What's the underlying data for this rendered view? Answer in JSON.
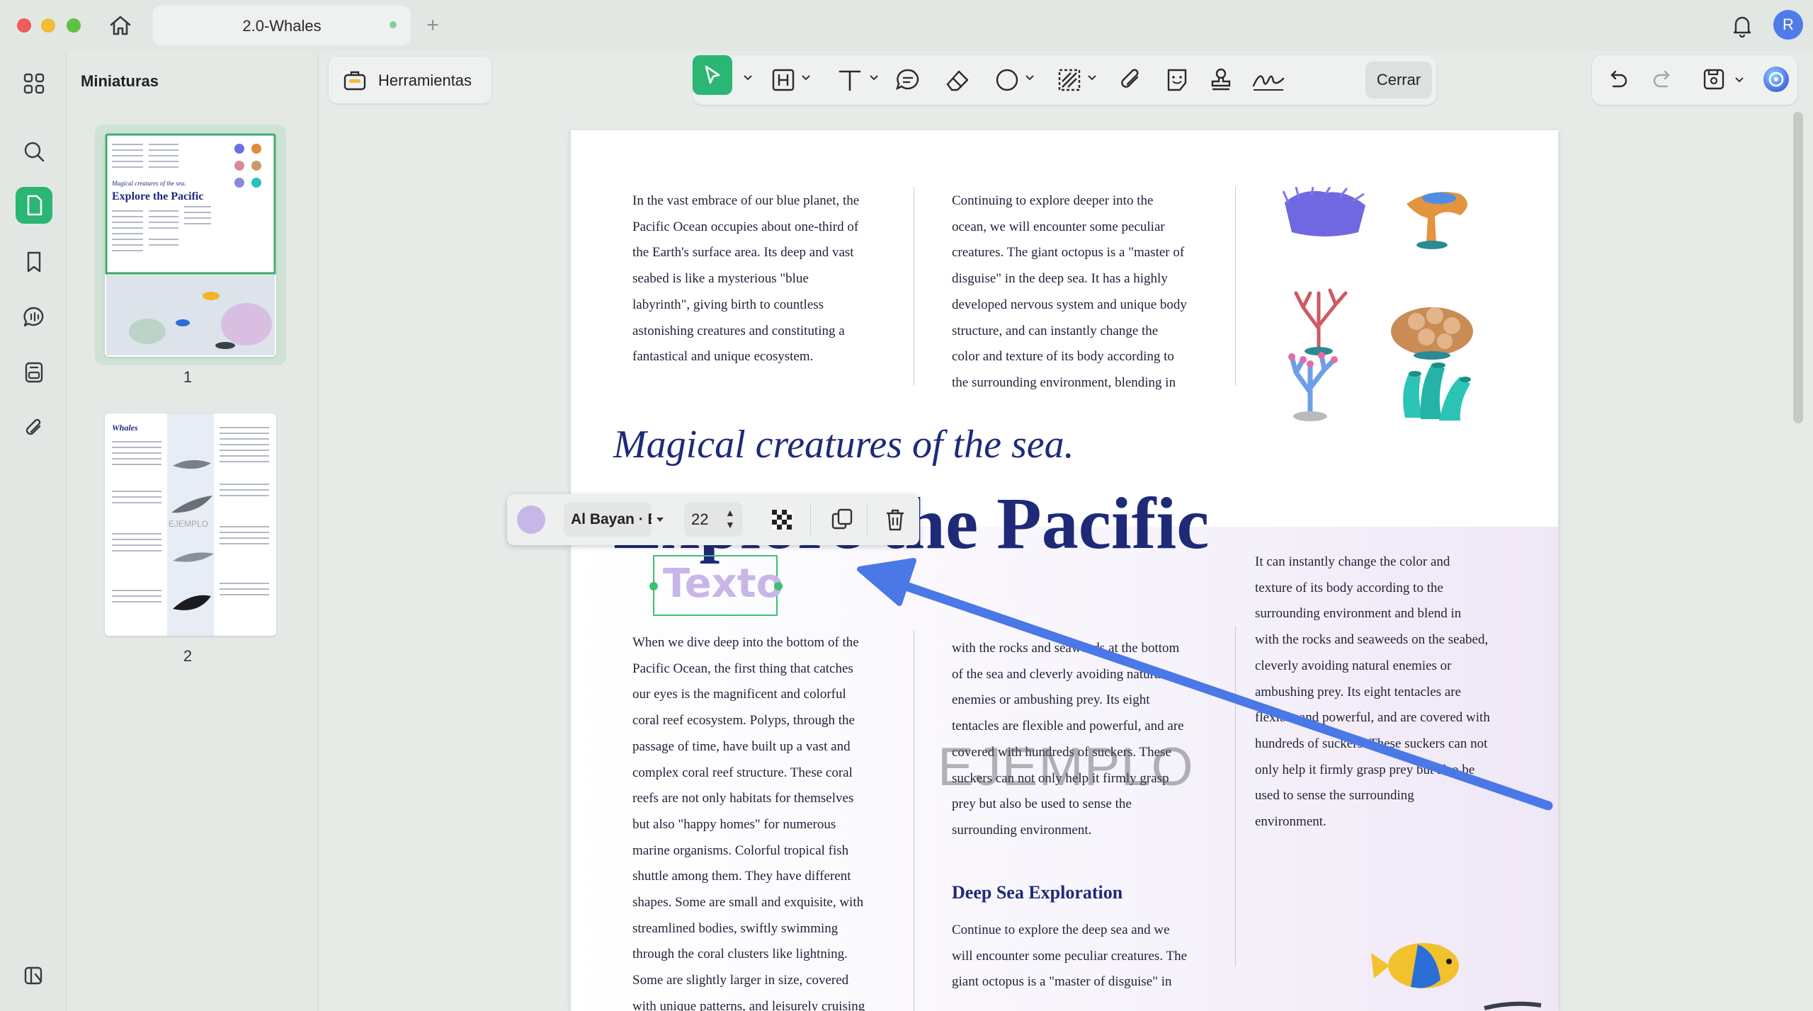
{
  "window": {
    "tab_title": "2.0-Whales",
    "new_tab_symbol": "+",
    "avatar_initial": "R"
  },
  "sidebar": {
    "panel_title": "Miniaturas",
    "rail_icons": [
      "grid-icon",
      "search-icon",
      "pages-icon",
      "bookmark-icon",
      "comment-icon",
      "form-icon",
      "attachment-icon"
    ],
    "active_icon": "pages-icon",
    "bottom_icon": "sidebar-toggle-icon",
    "thumbnails": [
      {
        "page": "1",
        "heading": "Explore the Pacific",
        "subheading": "Magical creatures of the sea."
      },
      {
        "page": "2",
        "heading": "Whales",
        "watermark": "EJEMPLO"
      }
    ]
  },
  "toolbar": {
    "tools_label": "Herramientas",
    "close_label": "Cerrar",
    "tools": [
      "select-icon",
      "text-box-icon",
      "text-icon",
      "comment-icon",
      "eraser-icon",
      "shape-icon",
      "area-icon",
      "attach-icon",
      "sticker-icon",
      "stamp-icon",
      "signature-icon"
    ],
    "history": [
      "undo-icon",
      "redo-icon",
      "save-icon",
      "ai-assistant-icon"
    ]
  },
  "text_toolbar": {
    "color": "#c8b6e8",
    "font": "Al Bayan · B",
    "font_size": "22"
  },
  "text_box": {
    "text": "Texto"
  },
  "document": {
    "col1_top": [
      "In the vast embrace of our blue planet, the",
      "Pacific Ocean occupies about one-third of",
      "the Earth's surface area. Its deep and vast",
      "seabed is like a mysterious \"blue",
      "labyrinth\", giving birth to countless",
      "astonishing creatures and constituting a",
      "fantastical and unique ecosystem."
    ],
    "col2_top": [
      "Continuing to explore deeper into the",
      "ocean, we will encounter some peculiar",
      "creatures. The giant octopus is a \"master of",
      "disguise\" in the deep sea. It has a highly",
      "developed nervous system and unique body",
      "structure, and can instantly change the",
      "color and texture of its body according to",
      "the surrounding environment, blending in"
    ],
    "subtitle": "Magical creatures of the sea.",
    "title": "Explore the Pacific",
    "col3_mid": [
      "It can instantly change the color and",
      "texture of its body according to the",
      "surrounding environment and blend in",
      "with the rocks and seaweeds on the seabed,",
      "cleverly avoiding natural enemies or",
      "ambushing prey. Its eight tentacles are",
      "flexible and powerful, and are covered with",
      "hundreds of suckers. These suckers can not",
      "only help it firmly grasp prey but also be",
      "used to sense the surrounding",
      "environment."
    ],
    "col1_bottom": [
      "When we dive deep into the bottom of the",
      "Pacific Ocean, the first thing that catches",
      "our eyes is the magnificent and colorful",
      "coral reef ecosystem. Polyps, through the",
      "passage of time, have built up a vast and",
      "complex coral reef structure. These coral",
      "reefs are not only habitats for themselves",
      "but also \"happy homes\" for numerous",
      "marine organisms. Colorful tropical fish",
      "shuttle among them. They have different",
      "shapes. Some are small and exquisite, with",
      "streamlined bodies, swiftly swimming",
      "through the coral clusters like lightning.",
      "Some are slightly larger in size, covered",
      "with unique patterns, and leisurely cruising"
    ],
    "col2_bottom": [
      "with the rocks and seaweeds at the bottom",
      "of the sea and cleverly avoiding natural",
      "enemies or ambushing prey. Its eight",
      "tentacles are flexible and powerful, and are",
      "covered with hundreds of suckers. These",
      "suckers can not only help it firmly grasp",
      "prey but also be used to sense the",
      "surrounding environment."
    ],
    "deep_heading": "Deep Sea Exploration",
    "deep_text": [
      "Continue to explore the deep sea and we",
      "will encounter some peculiar creatures. The",
      "giant octopus is a \"master of disguise\" in"
    ],
    "watermark": "EJEMPLO"
  },
  "colors": {
    "accent": "#2bb673",
    "title": "#1e2a78",
    "arrow": "#4a78e6"
  }
}
